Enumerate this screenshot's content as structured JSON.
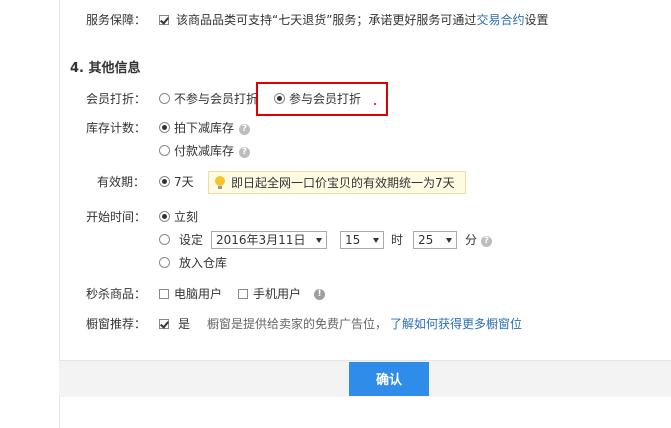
{
  "service": {
    "label": "服务保障：",
    "text": "该商品品类可支持“七天退货”服务；承诺更好服务可通过",
    "link": "交易合约",
    "suffix": "设置"
  },
  "section": {
    "title": "4. 其他信息"
  },
  "member_discount": {
    "label": "会员打折：",
    "opt1": "不参与会员打折",
    "opt2": "参与会员打折"
  },
  "stock": {
    "label": "库存计数：",
    "opt1": "拍下减库存",
    "opt2": "付款减库存"
  },
  "validity": {
    "label": "有效期：",
    "opt": "7天",
    "tip": "即日起全网一口价宝贝的有效期统一为7天"
  },
  "start_time": {
    "label": "开始时间：",
    "opt1": "立刻",
    "opt2": "设定",
    "date": "2016年3月11日",
    "hour": "15",
    "hour_unit": "时",
    "minute": "25",
    "minute_unit": "分",
    "opt3": "放入仓库"
  },
  "flash_sale": {
    "label": "秒杀商品：",
    "opt1": "电脑用户",
    "opt2": "手机用户"
  },
  "window": {
    "label": "橱窗推荐：",
    "opt": "是",
    "desc": "橱窗是提供给卖家的免费广告位，",
    "link": "了解如何获得更多橱窗位"
  },
  "confirm": "确认",
  "icons": {
    "help": "?",
    "warn": "!"
  }
}
